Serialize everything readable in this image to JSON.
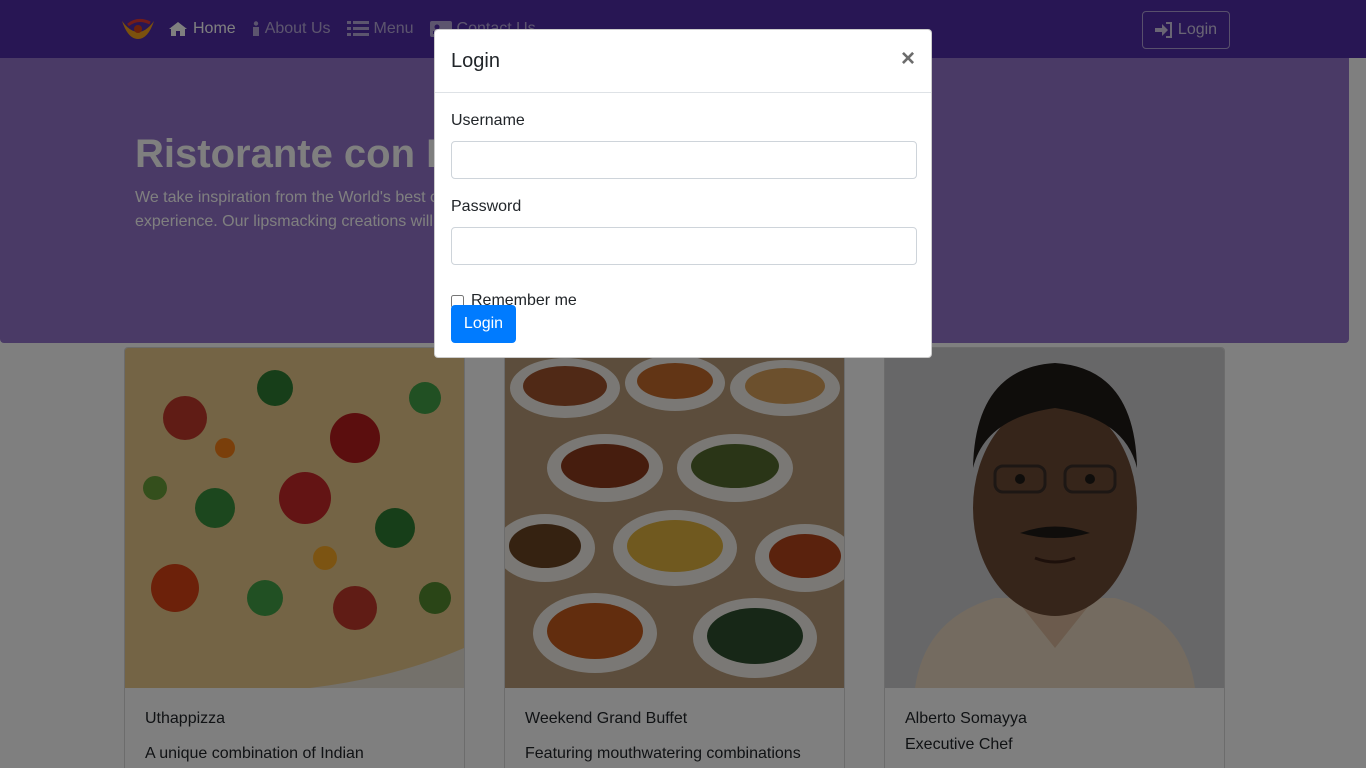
{
  "navbar": {
    "brand_icon": "restaurant-logo",
    "links": [
      {
        "label": "Home",
        "icon": "home-icon"
      },
      {
        "label": "About Us",
        "icon": "info-icon"
      },
      {
        "label": "Menu",
        "icon": "list-icon"
      },
      {
        "label": "Contact Us",
        "icon": "address-card-icon"
      }
    ],
    "login_label": "Login",
    "background": "#512DA8"
  },
  "jumbotron": {
    "title": "Ristorante con Fusion",
    "text": "We take inspiration from the World's best cuisines, and create a unique fusion experience. Our lipsmacking creations will tickle your culinary senses!",
    "background": "#9575CD"
  },
  "cards": [
    {
      "title": "Uthappizza",
      "subtitle": "",
      "text": "A unique combination of Indian"
    },
    {
      "title": "Weekend Grand Buffet",
      "subtitle": "",
      "text": "Featuring mouthwatering combinations"
    },
    {
      "title": "Alberto Somayya",
      "subtitle": "Executive Chef",
      "text": ""
    }
  ],
  "modal": {
    "title": "Login",
    "close_symbol": "×",
    "username_label": "Username",
    "username_value": "",
    "password_label": "Password",
    "password_value": "",
    "remember_label": "Remember me",
    "submit_label": "Login",
    "accent": "#007bff"
  }
}
